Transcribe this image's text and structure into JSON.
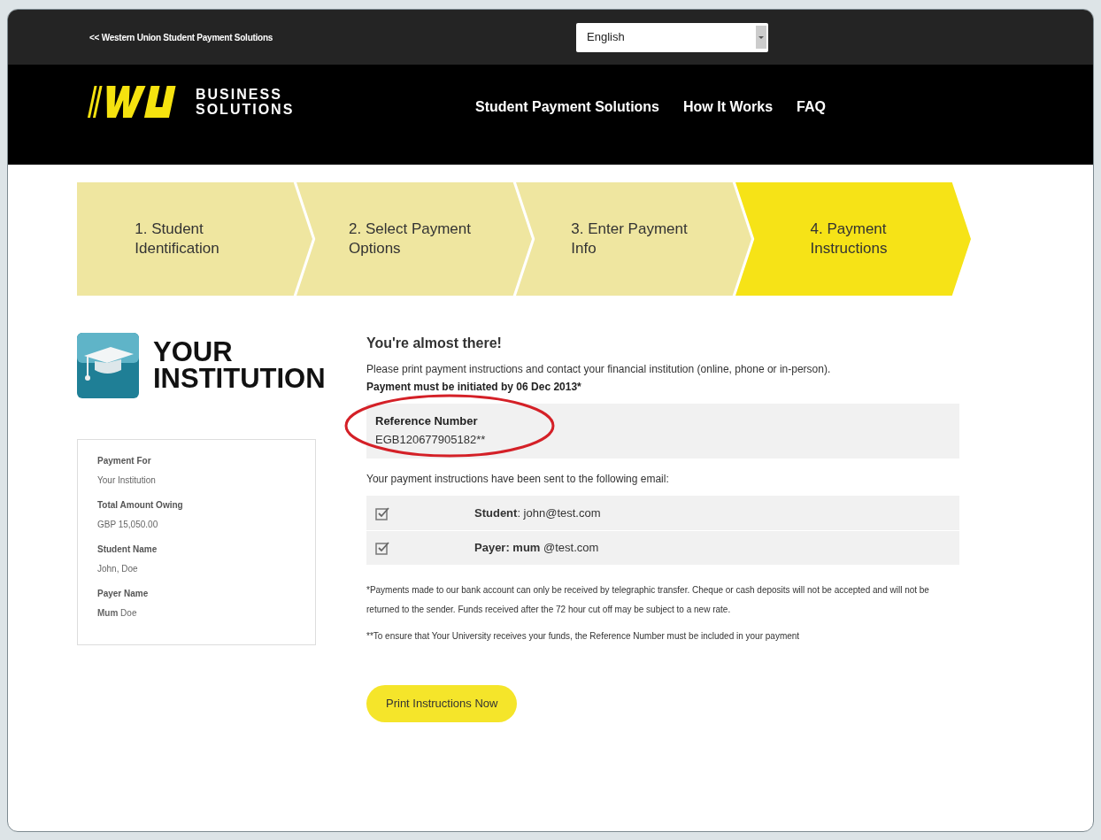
{
  "top_bar": {
    "back_link": "<< Western Union Student Payment Solutions",
    "language": {
      "value": "English"
    }
  },
  "header": {
    "logo_text": [
      "BUSINESS",
      "SOLUTIONS"
    ],
    "nav": [
      "Student Payment Solutions",
      "How It Works",
      "FAQ"
    ]
  },
  "steps": [
    {
      "label": "1. Student\nIdentification",
      "selected": false
    },
    {
      "label": "2. Select Payment\nOptions",
      "selected": false
    },
    {
      "label": "3. Enter Payment\nInfo",
      "selected": false
    },
    {
      "label": "4. Payment\nInstructions",
      "selected": true
    }
  ],
  "institution": {
    "name": "YOUR\nINSTITUTION"
  },
  "summary": [
    {
      "label": "Payment For",
      "value": "Your Institution"
    },
    {
      "label": "Total Amount Owing",
      "value": "GBP 15,050.00"
    },
    {
      "label": "Student Name",
      "value": "John, Doe"
    },
    {
      "label": "Payer Name",
      "value": "**Mum** Doe"
    }
  ],
  "heading": "You're almost there!",
  "intro": "Please print payment instructions and contact your financial institution (online, phone or in-person).",
  "deadline": "Payment must be initiated by 06 Dec 2013*",
  "reference": {
    "label": "Reference Number",
    "value": "EGB120677905182**"
  },
  "emails_intro": "Your payment instructions have been sent to the following email:",
  "emails": [
    {
      "text": "**Student**: john@test.com",
      "checked": true
    },
    {
      "text": "**Payer: mum** @test.com",
      "checked": true
    }
  ],
  "footnotes": [
    "*Payments made to our bank account can only be received by telegraphic transfer. Cheque or cash deposits will not be accepted and will not be returned to the sender. Funds received after the 72 hour cut off may be subject to a new rate.",
    "**To ensure that Your University receives your funds, the Reference Number must be included in your payment"
  ],
  "print_button": "Print Instructions Now"
}
